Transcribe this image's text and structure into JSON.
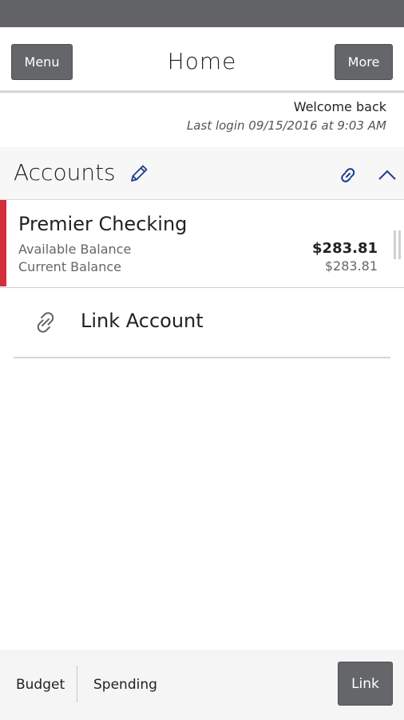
{
  "header": {
    "title": "Home",
    "menu_label": "Menu",
    "more_label": "More"
  },
  "welcome": {
    "greeting": "Welcome back",
    "last_login": "Last login 09/15/2016 at 9:03 AM"
  },
  "accounts": {
    "title": "Accounts",
    "items": [
      {
        "name": "Premier Checking",
        "available_label": "Available Balance",
        "available_value": "$283.81",
        "current_label": "Current Balance",
        "current_value": "$283.81",
        "accent_color": "#d32f3a"
      }
    ],
    "link_account_label": "Link Account"
  },
  "bottom_bar": {
    "budget_label": "Budget",
    "spending_label": "Spending",
    "link_label": "Link"
  },
  "colors": {
    "status_bar": "#616367",
    "button": "#64666a",
    "icon_accent": "#1f3b8f"
  },
  "icons": [
    "pencil-icon",
    "link-icon",
    "chevron-up-icon",
    "chain-link-icon"
  ]
}
